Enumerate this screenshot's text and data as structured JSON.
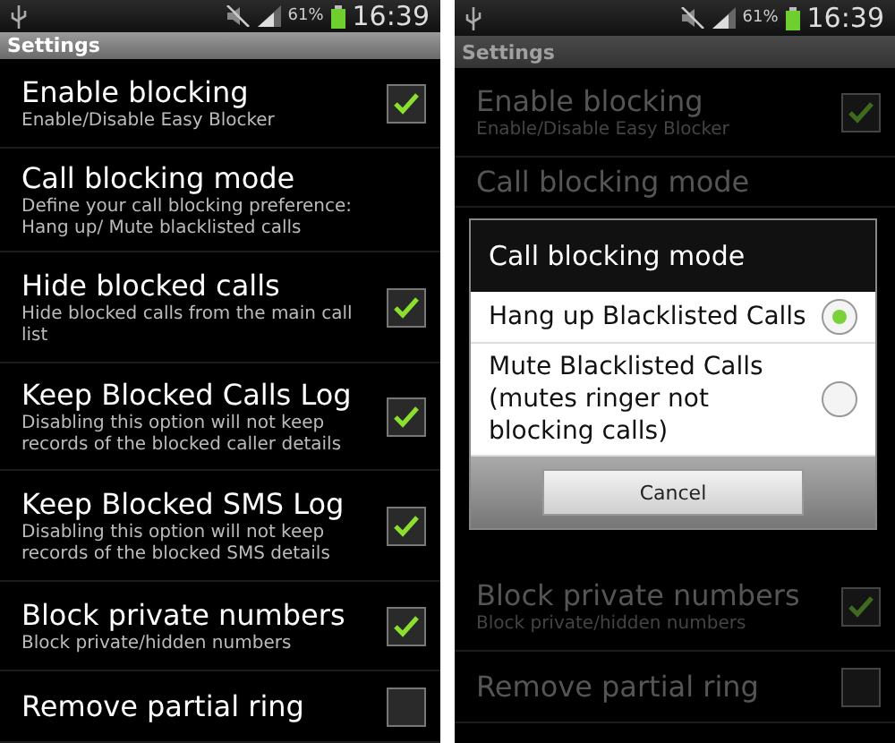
{
  "screens": [
    {
      "dimmed": false,
      "status_bar": {
        "battery": "61%",
        "time": "16:39"
      },
      "title": "Settings",
      "settings": [
        {
          "title": "Enable blocking",
          "subtitle": "Enable/Disable Easy Blocker",
          "kind": "checkbox",
          "checked": true
        },
        {
          "title": "Call blocking mode",
          "subtitle": "Define your call blocking preference: Hang up/ Mute blacklisted calls",
          "kind": "plain"
        },
        {
          "title": "Hide blocked calls",
          "subtitle": "Hide blocked calls from the main call list",
          "kind": "checkbox",
          "checked": true
        },
        {
          "title": "Keep Blocked Calls Log",
          "subtitle": "Disabling this option will not keep records of the blocked caller details",
          "kind": "checkbox",
          "checked": true
        },
        {
          "title": "Keep Blocked SMS Log",
          "subtitle": "Disabling this option will not keep records of the blocked SMS details",
          "kind": "checkbox",
          "checked": true
        },
        {
          "title": "Block private numbers",
          "subtitle": "Block private/hidden numbers",
          "kind": "checkbox",
          "checked": true
        },
        {
          "title": "Remove partial ring",
          "kind": "checkbox",
          "checked": false
        }
      ]
    },
    {
      "dimmed": true,
      "status_bar": {
        "battery": "61%",
        "time": "16:39"
      },
      "title": "Settings",
      "settings": [
        {
          "title": "Enable blocking",
          "subtitle": "Enable/Disable Easy Blocker",
          "kind": "checkbox",
          "checked": true
        },
        {
          "title": "Call blocking mode",
          "kind": "plain"
        },
        {
          "kind": "dialog"
        },
        {
          "title": "Block private numbers",
          "subtitle": "Block private/hidden numbers",
          "kind": "checkbox",
          "checked": true
        },
        {
          "title": "Remove partial ring",
          "kind": "checkbox",
          "checked": false
        }
      ],
      "dialog": {
        "title": "Call blocking mode",
        "options": [
          {
            "label": "Hang up Blacklisted Calls",
            "selected": true
          },
          {
            "label": "Mute Blacklisted Calls (mutes ringer not blocking calls)",
            "selected": false
          }
        ],
        "button": "Cancel"
      }
    }
  ]
}
